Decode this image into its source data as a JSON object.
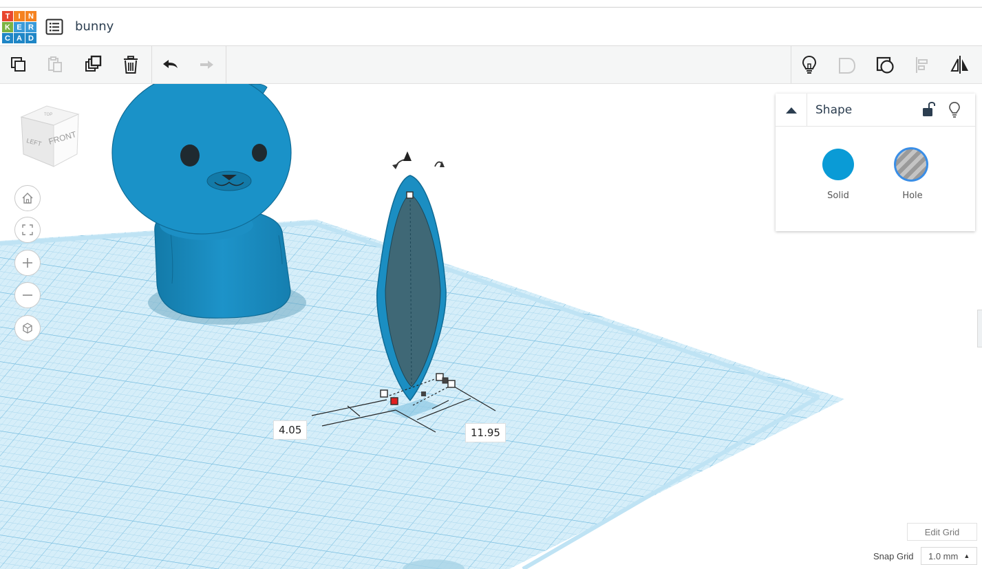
{
  "app": {
    "logo_letters": [
      "T",
      "I",
      "N",
      "K",
      "E",
      "R",
      "C",
      "A",
      "D"
    ],
    "logo_colors": [
      "#e8462e",
      "#f58220",
      "#f58220",
      "#7cb342",
      "#3a9bd9",
      "#3a9bd9",
      "#1f86c6",
      "#1f86c6",
      "#1f86c6"
    ],
    "project_name": "bunny"
  },
  "toolbar": {
    "left_tools": [
      {
        "name": "copy",
        "icon": "copy-icon"
      },
      {
        "name": "paste",
        "icon": "paste-icon"
      },
      {
        "name": "duplicate",
        "icon": "duplicate-icon"
      },
      {
        "name": "delete",
        "icon": "trash-icon"
      },
      {
        "name": "undo",
        "icon": "undo-icon"
      },
      {
        "name": "redo",
        "icon": "redo-icon"
      }
    ],
    "right_tools": [
      {
        "name": "show-all",
        "icon": "lightbulb-icon"
      },
      {
        "name": "group",
        "icon": "group-icon"
      },
      {
        "name": "ungroup",
        "icon": "ungroup-icon"
      },
      {
        "name": "align",
        "icon": "align-icon"
      },
      {
        "name": "mirror",
        "icon": "mirror-icon"
      }
    ]
  },
  "viewcube": {
    "front": "FRONT",
    "left": "LEFT",
    "top": "TOP"
  },
  "nav": [
    "home-icon",
    "fit-icon",
    "zoom-in-icon",
    "zoom-out-icon",
    "perspective-icon"
  ],
  "dimensions": {
    "width": "4.05",
    "length": "11.95"
  },
  "shape_panel": {
    "title": "Shape",
    "solid_label": "Solid",
    "hole_label": "Hole",
    "solid_color": "#0a9bd6"
  },
  "grid": {
    "edit_label": "Edit Grid",
    "snap_label": "Snap Grid",
    "snap_value": "1.0 mm"
  },
  "colors": {
    "shape": "#1b8ec2",
    "workplane": "#cfeaf7",
    "grid_line": "#8ac9e6",
    "toolbar_bg": "#f5f6f6"
  }
}
